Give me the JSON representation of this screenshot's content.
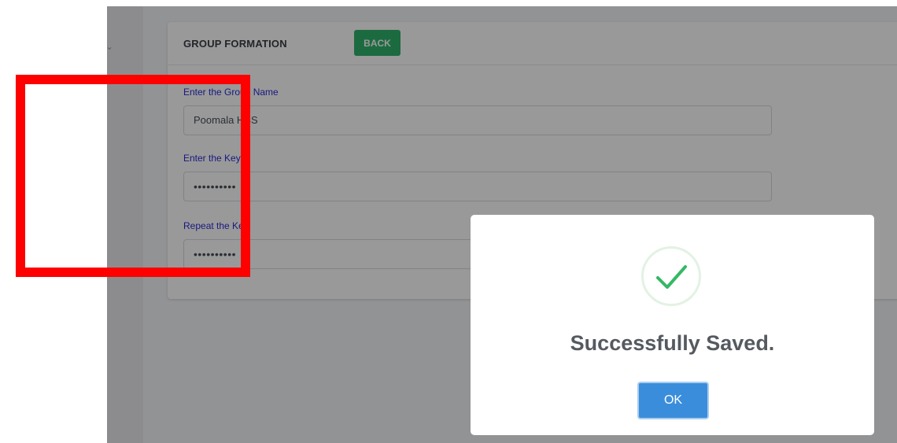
{
  "form": {
    "title": "GROUP FORMATION",
    "back_label": "BACK",
    "fields": [
      {
        "label": "Enter the Group Name",
        "value": "Poomala HSS"
      },
      {
        "label": "Enter the Key",
        "value": "••••••••••"
      },
      {
        "label": "Repeat the Key",
        "value": "••••••••••"
      }
    ]
  },
  "dialog": {
    "message": "Successfully Saved.",
    "ok_label": "OK",
    "icon": "check-icon",
    "accent_color": "#3a8ddb",
    "check_color": "#35b865"
  }
}
